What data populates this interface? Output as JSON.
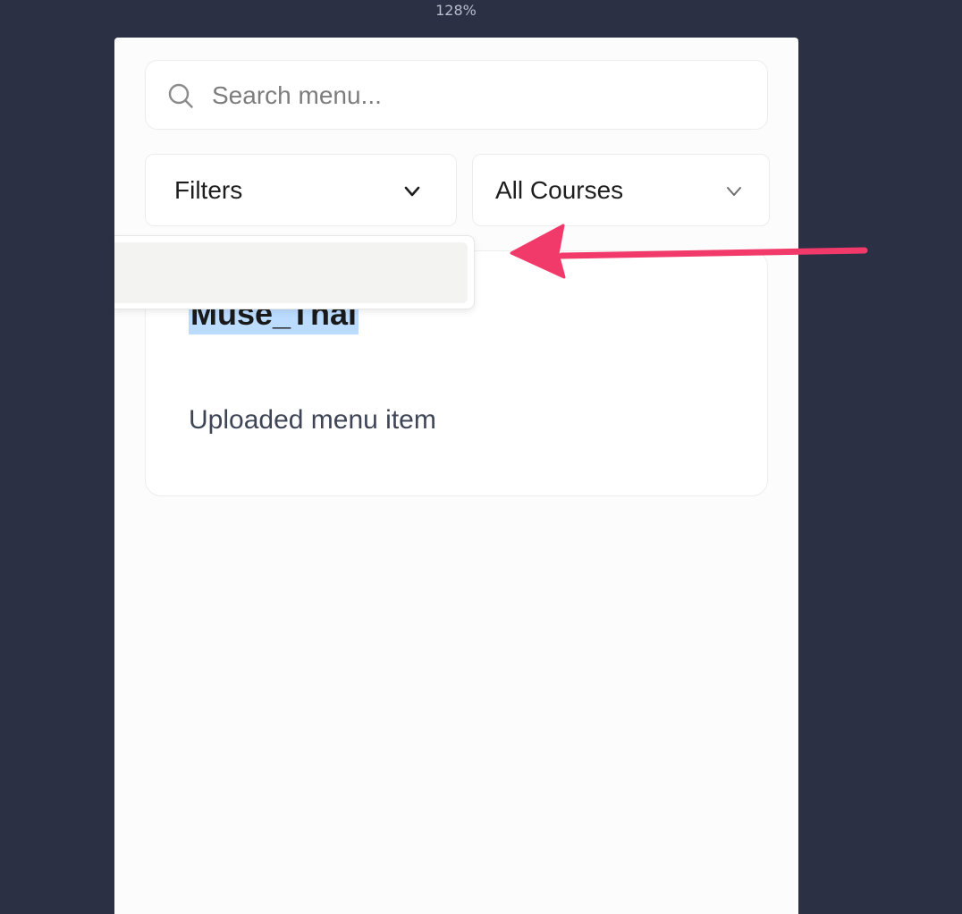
{
  "zoom": {
    "level": "128%"
  },
  "search": {
    "placeholder": "Search menu...",
    "value": ""
  },
  "filters": {
    "label": "Filters"
  },
  "courses": {
    "label": "All Courses"
  },
  "dropdown": {
    "option_label": ""
  },
  "card": {
    "title": "Muse_Thai",
    "description": "Uploaded menu item"
  },
  "colors": {
    "background": "#2c3044",
    "panel": "#fcfcfc",
    "selection": "#bcdcff",
    "annotation_arrow": "#f23a6a"
  },
  "icons": {
    "search": "search-icon",
    "filters_chevron": "chevron-down-icon",
    "courses_chevron": "chevron-down-icon"
  }
}
